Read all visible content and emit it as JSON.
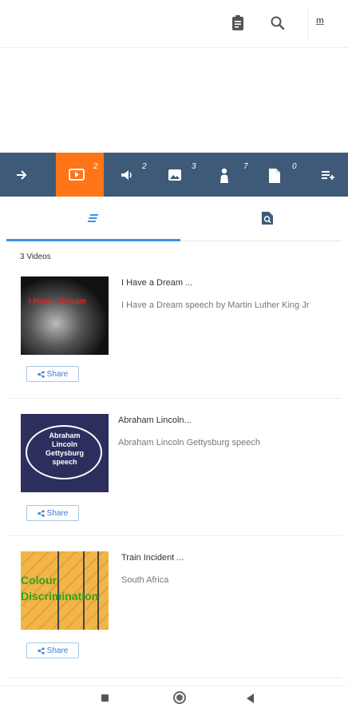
{
  "header": {
    "logo_text": "m"
  },
  "toolbar": {
    "badges": {
      "video": "2",
      "audio": "2",
      "image": "3",
      "people": "7",
      "doc": "0"
    }
  },
  "list": {
    "count_label": "3 Videos",
    "items": [
      {
        "title": "I Have a Dream ...",
        "description": "I Have a Dream speech by Martin Luther King Jr",
        "thumb_text": "I Have a Dream",
        "share_label": "Share"
      },
      {
        "title": "Abraham Lincoln...",
        "description": "Abraham Lincoln Gettysburg speech",
        "thumb_text_lines": [
          "Abraham",
          "Lincoln",
          "Gettysburg",
          "speech"
        ],
        "share_label": "Share"
      },
      {
        "title": "Train Incident ...",
        "description": "South Africa",
        "thumb_text_lines": [
          "Colour",
          "Discrimination"
        ],
        "share_label": "Share"
      }
    ]
  },
  "colors": {
    "toolbar_bg": "#3f5a78",
    "toolbar_active": "#ff7518",
    "accent_blue": "#3d8fe8"
  }
}
